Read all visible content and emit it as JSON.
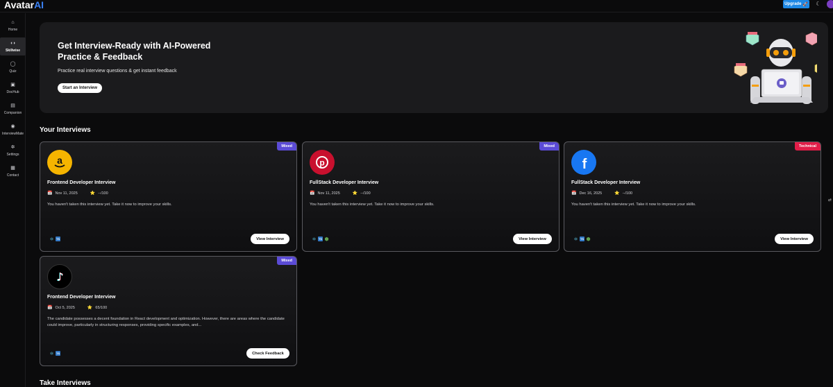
{
  "app": {
    "logo_main": "Avatar",
    "logo_accent": "AI"
  },
  "topbar": {
    "upgrade_label": "Upgrade",
    "upgrade_icon": "rocket-icon",
    "theme_icon": "moon-icon"
  },
  "sidebar": {
    "items": [
      {
        "label": "Home",
        "icon": "home-icon",
        "glyph": "⌂",
        "active": false
      },
      {
        "label": "Skillwise",
        "icon": "sound-wave-icon",
        "glyph": "◖◗",
        "active": true
      },
      {
        "label": "Quiz",
        "icon": "lightbulb-icon",
        "glyph": "◯",
        "active": false
      },
      {
        "label": "DocHub",
        "icon": "briefcase-icon",
        "glyph": "▣",
        "active": false
      },
      {
        "label": "Companion",
        "icon": "robot-icon",
        "glyph": "▤",
        "active": false
      },
      {
        "label": "InterviewMate",
        "icon": "person-icon",
        "glyph": "◉",
        "active": false
      },
      {
        "label": "Settings",
        "icon": "gear-icon",
        "glyph": "✲",
        "active": false
      },
      {
        "label": "Contact",
        "icon": "contact-icon",
        "glyph": "▦",
        "active": false
      }
    ]
  },
  "hero": {
    "title": "Get Interview-Ready with AI-Powered Practice & Feedback",
    "subtitle": "Practice real interview questions & get instant feedback",
    "cta": "Start an Interview"
  },
  "sections": {
    "your_interviews": "Your Interviews",
    "take_interviews": "Take Interviews"
  },
  "cards": [
    {
      "company_icon": "amazon-logo-icon",
      "company_color": "#f5b400",
      "badge": "Mixed",
      "title": "Frontend Developer Interview",
      "date": "Nov 11, 2025",
      "score": "--/100",
      "description": "You haven't taken this interview yet. Take it now to improve your skills.",
      "techs": [
        "react",
        "ts"
      ],
      "button": "View Interview"
    },
    {
      "company_icon": "pinterest-logo-icon",
      "company_color": "#c8102e",
      "badge": "Mixed",
      "title": "FullStack Developer Interview",
      "date": "Nov 11, 2025",
      "score": "--/100",
      "description": "You haven't taken this interview yet. Take it now to improve your skills.",
      "techs": [
        "react",
        "ts",
        "node"
      ],
      "button": "View Interview"
    },
    {
      "company_icon": "facebook-logo-icon",
      "company_color": "#1877f2",
      "badge": "Technical",
      "title": "FullStack Developer Interview",
      "date": "Dec 16, 2025",
      "score": "--/100",
      "description": "You haven't taken this interview yet. Take it now to improve your skills.",
      "techs": [
        "react",
        "ts",
        "node"
      ],
      "button": "View Interview"
    },
    {
      "company_icon": "tiktok-logo-icon",
      "company_color": "#000000",
      "badge": "Mixed",
      "title": "Frontend Developer Interview",
      "date": "Oct 5, 2025",
      "score": "65/100",
      "description": "The candidate possesses a decent foundation in React development and optimization. However, there are areas where the candidate could improve, particularly in structuring responses, providing specific examples, and...",
      "techs": [
        "react",
        "ts"
      ],
      "button": "Check Feedback"
    }
  ]
}
